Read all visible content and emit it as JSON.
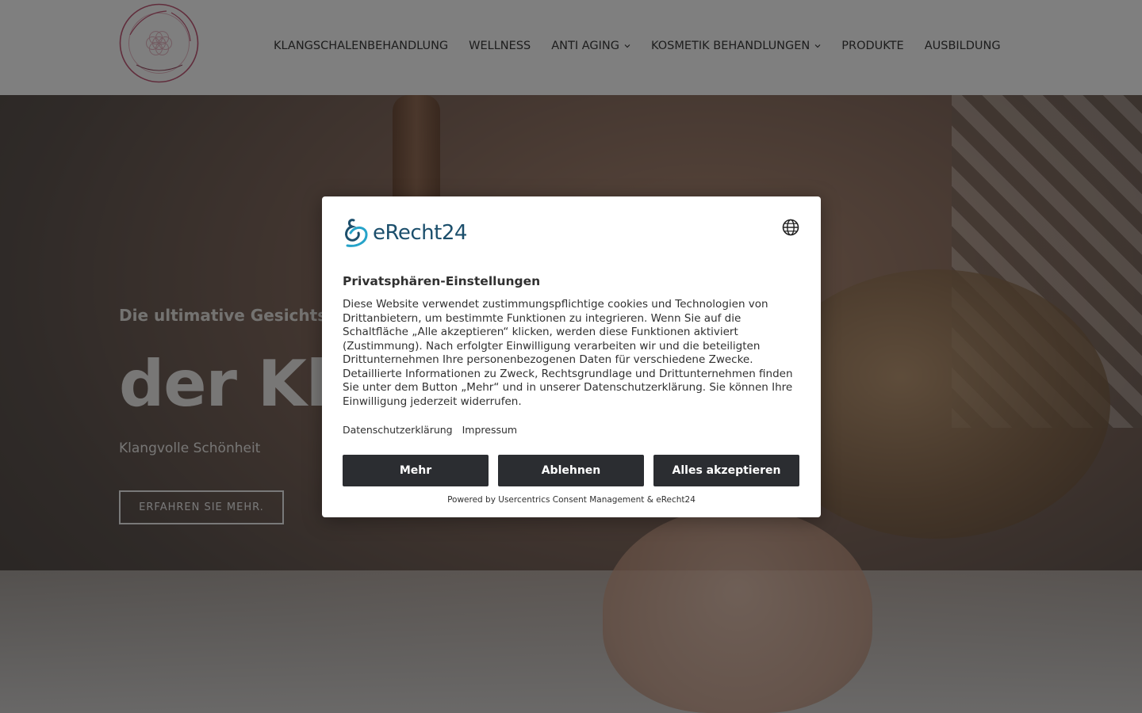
{
  "header": {
    "logo_text": "BEAUTY FEEL & HEAL · SABINA STEGEMANN",
    "nav": [
      {
        "label": "KLANGSCHALENBEHANDLUNG",
        "dropdown": false
      },
      {
        "label": "WELLNESS",
        "dropdown": false
      },
      {
        "label": "ANTI AGING",
        "dropdown": true
      },
      {
        "label": "KOSMETIK BEHANDLUNGEN",
        "dropdown": true
      },
      {
        "label": "PRODUKTE",
        "dropdown": false
      },
      {
        "label": "AUSBILDUNG",
        "dropdown": false
      }
    ]
  },
  "hero": {
    "kicker": "Die ultimative Gesichtsb",
    "title": "der Kl",
    "subtitle": "Klangvolle Schönheit",
    "button": "ERFAHREN SIE MEHR."
  },
  "consent": {
    "brand": "eRecht24",
    "title": "Privatsphären-Einstellungen",
    "text": "Diese Website verwendet zustimmungspflichtige cookies und Technologien von Drittanbietern, um bestimmte Funktionen zu integrieren. Wenn Sie auf die Schaltfläche „Alle akzeptieren“ klicken, werden diese Funktionen aktiviert (Zustimmung). Nach erfolgter Einwilligung verarbeiten wir und die beteiligten Drittunternehmen Ihre personenbezogenen Daten für verschiedene Zwecke. Detaillierte Informationen zu Zweck, Rechtsgrundlage und Drittunternehmen finden Sie unter dem Button „Mehr“ und in unserer Datenschutzerklärung. Sie können Ihre Einwilligung jederzeit widerrufen.",
    "links": {
      "privacy": "Datenschutzerklärung",
      "imprint": "Impressum"
    },
    "buttons": {
      "more": "Mehr",
      "reject": "Ablehnen",
      "accept": "Alles akzeptieren"
    },
    "powered_by": "Powered by Usercentrics Consent Management & eRecht24"
  },
  "colors": {
    "button_bg": "#2b2d31",
    "brand_blue": "#1c4f6c",
    "logo_pink": "#c25a78"
  }
}
